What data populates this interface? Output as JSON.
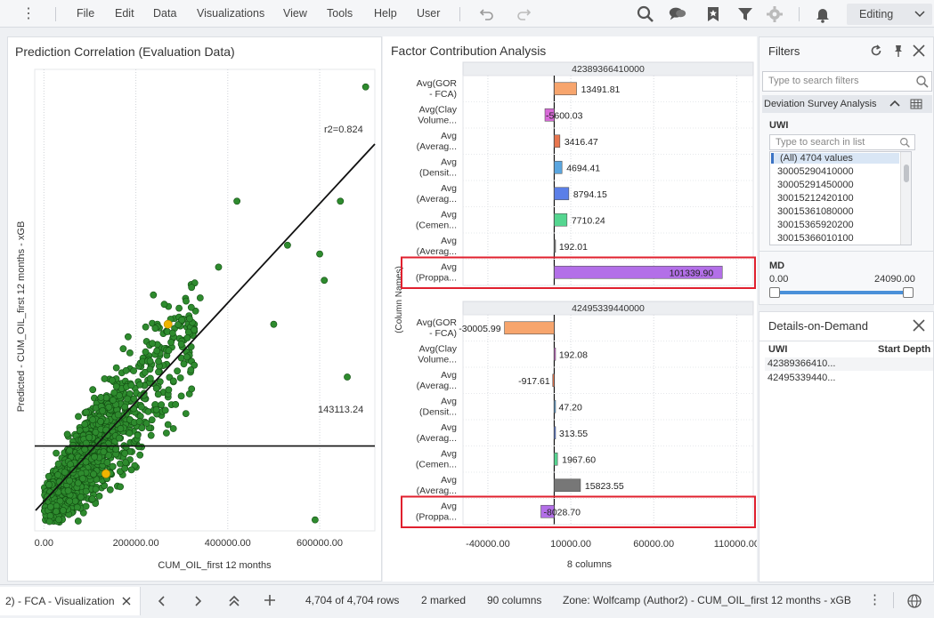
{
  "menubar": {
    "items": [
      "File",
      "Edit",
      "Data",
      "Visualizations",
      "View",
      "Tools",
      "Help",
      "User"
    ],
    "mode_label": "Editing",
    "icons": [
      "menu-icon",
      "undo-icon",
      "redo-icon",
      "search-icon",
      "chat-icon",
      "bookmark-icon",
      "filter-icon",
      "settings-icon",
      "notifications-icon",
      "chevron-down-icon"
    ]
  },
  "scatter": {
    "title": "Prediction Correlation (Evaluation Data)",
    "xlabel": "CUM_OIL_first 12 months",
    "ylabel": "Predicted - CUM_OIL_first 12 months - xGB",
    "r2_label": "r2=0.824",
    "hline_label": "143113.24",
    "x_ticks": [
      "0.00",
      "200000.00",
      "400000.00",
      "600000.00"
    ]
  },
  "fca": {
    "title": "Factor Contribution Analysis",
    "y_axis_label": "(Column Names)",
    "x_axis_label": "8 columns",
    "x_ticks": [
      "-40000.00",
      "10000.00",
      "60000.00",
      "110000.00"
    ],
    "panels": [
      {
        "header": "42389366410000",
        "rows": [
          {
            "label1": "Avg(GOR",
            "label2": "- FCA)",
            "value": 13491.81,
            "text": "13491.81"
          },
          {
            "label1": "Avg(Clay",
            "label2": "Volume...",
            "value": -5600.03,
            "text": "-5600.03"
          },
          {
            "label1": "Avg",
            "label2": "(Averag...",
            "value": 3416.47,
            "text": "3416.47"
          },
          {
            "label1": "Avg",
            "label2": "(Densit...",
            "value": 4694.41,
            "text": "4694.41"
          },
          {
            "label1": "Avg",
            "label2": "(Averag...",
            "value": 8794.15,
            "text": "8794.15"
          },
          {
            "label1": "Avg",
            "label2": "(Cemen...",
            "value": 7710.24,
            "text": "7710.24"
          },
          {
            "label1": "Avg",
            "label2": "(Averag...",
            "value": 192.01,
            "text": "192.01"
          },
          {
            "label1": "Avg",
            "label2": "(Proppa...",
            "value": 101339.9,
            "text": "101339.90"
          }
        ]
      },
      {
        "header": "42495339440000",
        "rows": [
          {
            "label1": "Avg(GOR",
            "label2": "- FCA)",
            "value": -30005.99,
            "text": "-30005.99"
          },
          {
            "label1": "Avg(Clay",
            "label2": "Volume...",
            "value": 192.08,
            "text": "192.08"
          },
          {
            "label1": "Avg",
            "label2": "(Averag...",
            "value": -917.61,
            "text": "-917.61"
          },
          {
            "label1": "Avg",
            "label2": "(Densit...",
            "value": 47.2,
            "text": "47.20"
          },
          {
            "label1": "Avg",
            "label2": "(Averag...",
            "value": 313.55,
            "text": "313.55"
          },
          {
            "label1": "Avg",
            "label2": "(Cemen...",
            "value": 1967.6,
            "text": "1967.60"
          },
          {
            "label1": "Avg",
            "label2": "(Averag...",
            "value": 15823.55,
            "text": "15823.55"
          },
          {
            "label1": "Avg",
            "label2": "(Proppa...",
            "value": -8028.7,
            "text": "-8028.70"
          }
        ]
      }
    ],
    "bar_colors": [
      "#f7a56d",
      "#d86ad8",
      "#e8764f",
      "#5aa6e0",
      "#5b7fe8",
      "#55d690",
      "#777777",
      "#b36fe8"
    ],
    "highlight_color": "#e0202e"
  },
  "filters": {
    "title": "Filters",
    "search_placeholder": "Type to search filters",
    "section": "Deviation Survey Analysis",
    "uwi_label": "UWI",
    "list_placeholder": "Type to search in list",
    "list_items": [
      "(All) 4704 values",
      "30005290410000",
      "30005291450000",
      "30015212420100",
      "30015361080000",
      "30015365920200",
      "30015366010100"
    ],
    "md_label": "MD",
    "md_min": "0.00",
    "md_max": "24090.00"
  },
  "details": {
    "title": "Details-on-Demand",
    "columns": [
      "UWI",
      "Start Depth"
    ],
    "rows": [
      "42389366410...",
      "42495339440..."
    ]
  },
  "statusbar": {
    "tab_label": "2) - FCA - Visualization",
    "rows": "4,704 of 4,704 rows",
    "marked": "2 marked",
    "columns": "90 columns",
    "zone": "Zone: Wolfcamp (Author2) - CUM_OIL_first 12 months - xGB"
  },
  "chart_data": [
    {
      "type": "scatter",
      "title": "Prediction Correlation (Evaluation Data)",
      "xlabel": "CUM_OIL_first 12 months",
      "ylabel": "Predicted - CUM_OIL_first 12 months - xGB",
      "xlim": [
        -20000,
        720000
      ],
      "ylim": [
        -50000,
        1000000
      ],
      "r2": 0.824,
      "hline": 143113.24,
      "point_color": "#2e8b2e",
      "marked_color": "#f0b400",
      "highlighted_points": [
        [
          270000,
          420000
        ],
        [
          135000,
          80000
        ]
      ],
      "outlier_points": [
        [
          700000,
          960000
        ],
        [
          645000,
          700000
        ],
        [
          660000,
          300000
        ],
        [
          610000,
          520000
        ],
        [
          600000,
          580000
        ],
        [
          530000,
          600000
        ],
        [
          420000,
          700000
        ],
        [
          380000,
          550000
        ],
        [
          340000,
          480000
        ],
        [
          300000,
          430000
        ],
        [
          280000,
          400000
        ],
        [
          500000,
          420000
        ],
        [
          590000,
          -25000
        ]
      ]
    },
    {
      "type": "bar",
      "title": "Factor Contribution Analysis",
      "xlabel": "8 columns",
      "ylabel": "(Column Names)",
      "xlim": [
        -55000,
        120000
      ]
    }
  ]
}
